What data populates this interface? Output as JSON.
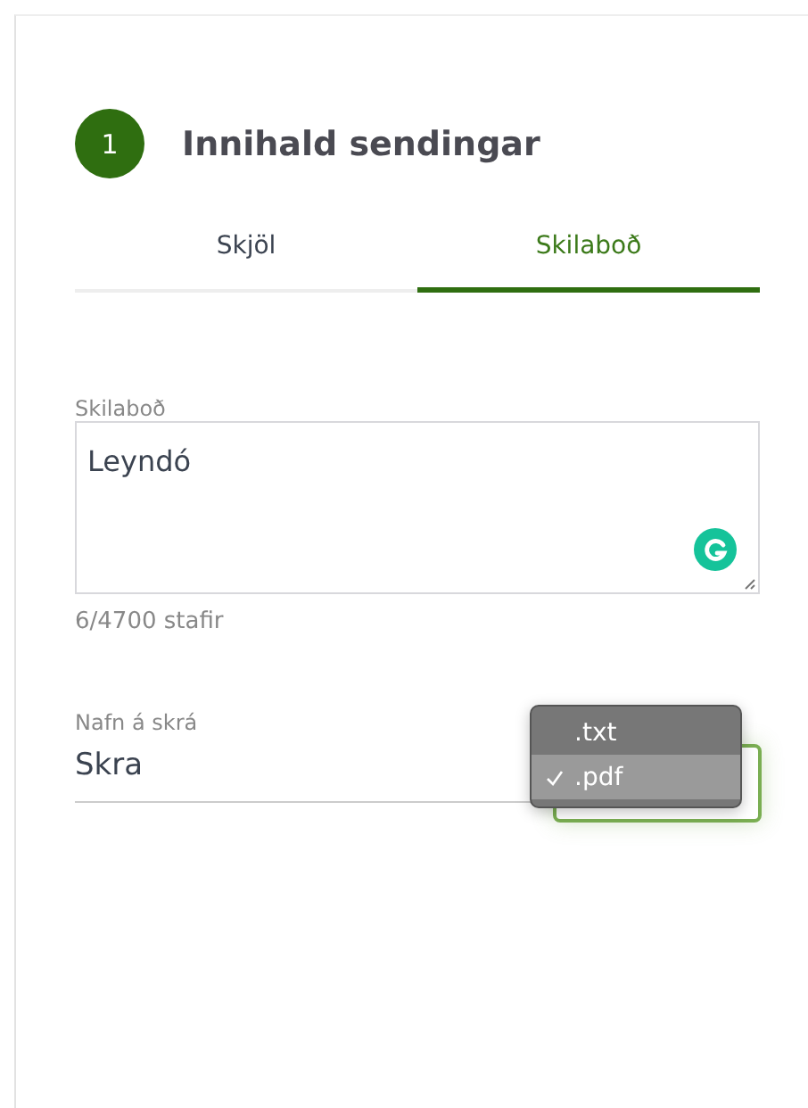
{
  "section": {
    "number": "1",
    "title": "Innihald sendingar"
  },
  "tabs": [
    {
      "label": "Skjöl",
      "selected": false
    },
    {
      "label": "Skilaboð",
      "selected": true
    }
  ],
  "message": {
    "label": "Skilaboð",
    "value": "Leyndó",
    "counter": "6/4700 stafir"
  },
  "filename": {
    "label": "Nafn á skrá",
    "value": "Skra"
  },
  "format_menu": {
    "options": [
      {
        "label": ".txt",
        "selected": false
      },
      {
        "label": ".pdf",
        "selected": true
      }
    ]
  }
}
